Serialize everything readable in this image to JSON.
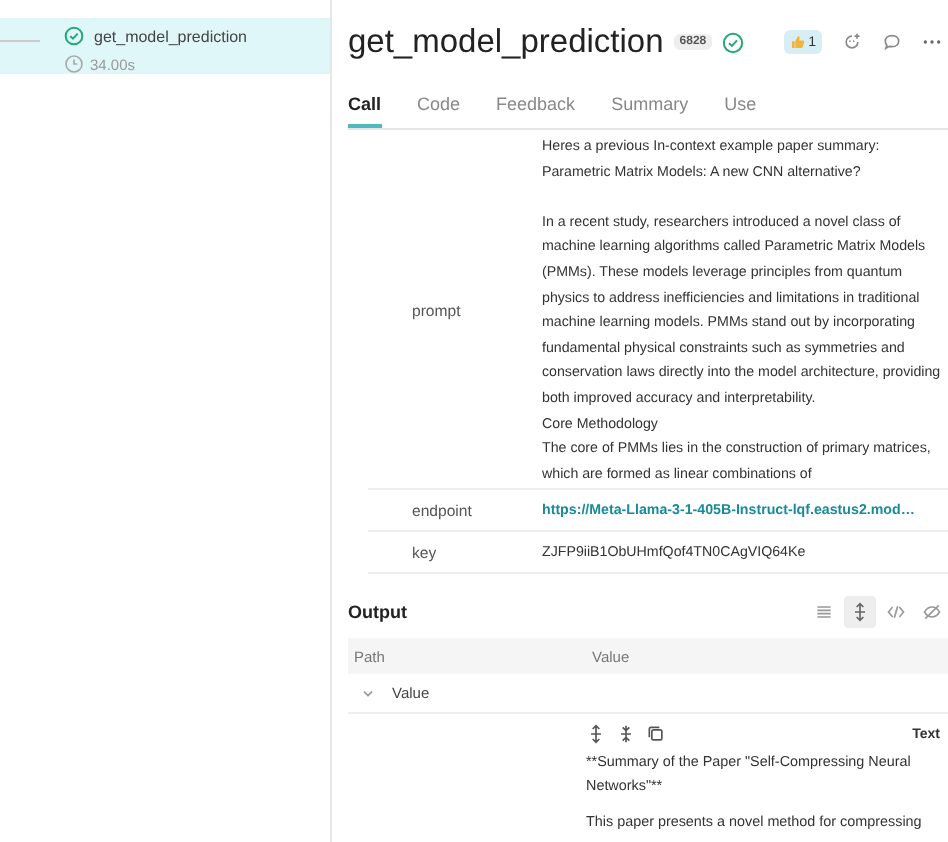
{
  "sidebar": {
    "items": [
      {
        "name": "get_model_prediction",
        "duration": "34.00s",
        "selected": true
      }
    ]
  },
  "header": {
    "title": "get_model_prediction",
    "badge": "6828",
    "reaction_count": "1"
  },
  "tabs": [
    {
      "label": "Call",
      "selected": true
    },
    {
      "label": "Code",
      "selected": false
    },
    {
      "label": "Feedback",
      "selected": false
    },
    {
      "label": "Summary",
      "selected": false
    },
    {
      "label": "Use",
      "selected": false
    }
  ],
  "inputs": [
    {
      "key": "prompt",
      "kind": "text",
      "value": "Heres a previous In-context example paper summary:\nParametric Matrix Models: A new CNN alternative?\n\nIn a recent study, researchers introduced a novel class of machine learning algorithms called Parametric Matrix Models (PMMs). These models leverage principles from quantum physics to address inefficiencies and limitations in traditional machine learning models. PMMs stand out by incorporating fundamental physical constraints such as symmetries and conservation laws directly into the model architecture, providing both improved accuracy and interpretability.\nCore Methodology\nThe core of PMMs lies in the construction of primary matrices, which are formed as linear combinations of"
    },
    {
      "key": "endpoint",
      "kind": "link",
      "value": "https://Meta-Llama-3-1-405B-Instruct-lqf.eastus2.mod…"
    },
    {
      "key": "key",
      "kind": "text",
      "value": "ZJFP9iiB1ObUHmfQof4TN0CAgVIQ64Ke"
    }
  ],
  "output": {
    "title": "Output",
    "view_modes": [
      {
        "kind": "list",
        "selected": false
      },
      {
        "kind": "expand",
        "selected": true
      },
      {
        "kind": "code",
        "selected": false
      },
      {
        "kind": "hidden",
        "selected": false
      }
    ],
    "columns": [
      "Path",
      "Value"
    ],
    "row": {
      "path": "Value",
      "expanded": true
    },
    "value_type": "Text",
    "paragraphs": [
      "**Summary of the Paper \"Self-Compressing Neural Networks\"**",
      "This paper presents a novel method for compressing"
    ]
  }
}
